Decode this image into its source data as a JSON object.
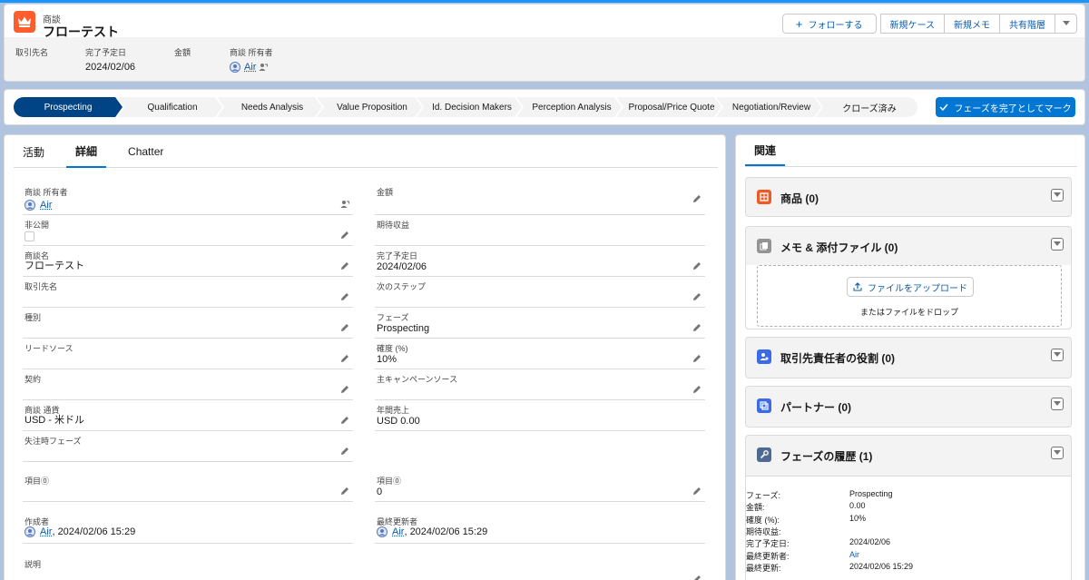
{
  "header": {
    "object_type": "商談",
    "record_name": "フローテスト",
    "actions": {
      "follow": "フォローする",
      "new_case": "新規ケース",
      "new_note": "新規メモ",
      "shared_hierarchy": "共有階層"
    },
    "highlights": [
      {
        "label": "取引先名",
        "value": ""
      },
      {
        "label": "完了予定日",
        "value": "2024/02/06"
      },
      {
        "label": "金額",
        "value": ""
      },
      {
        "label": "商談 所有者",
        "value": "Air"
      }
    ]
  },
  "path": {
    "steps": [
      "Prospecting",
      "Qualification",
      "Needs Analysis",
      "Value Proposition",
      "Id. Decision Makers",
      "Perception Analysis",
      "Proposal/Price Quote",
      "Negotiation/Review",
      "クローズ済み"
    ],
    "active_step": "Prospecting",
    "complete_button": "フェーズを完了としてマーク"
  },
  "tabs": [
    "活動",
    "詳細",
    "Chatter"
  ],
  "active_tab": "詳細",
  "details": {
    "owner": {
      "label": "商談 所有者",
      "value": "Air"
    },
    "amount": {
      "label": "金額",
      "value": ""
    },
    "private": {
      "label": "非公開",
      "checked": false
    },
    "expected_revenue": {
      "label": "期待収益",
      "value": ""
    },
    "name": {
      "label": "商談名",
      "value": "フローテスト"
    },
    "close_date": {
      "label": "完了予定日",
      "value": "2024/02/06"
    },
    "account": {
      "label": "取引先名",
      "value": ""
    },
    "next_step": {
      "label": "次のステップ",
      "value": ""
    },
    "type": {
      "label": "種別",
      "value": ""
    },
    "stage": {
      "label": "フェーズ",
      "value": "Prospecting"
    },
    "lead_source": {
      "label": "リードソース",
      "value": ""
    },
    "probability": {
      "label": "確度 (%)",
      "value": "10%"
    },
    "contract": {
      "label": "契約",
      "value": ""
    },
    "campaign": {
      "label": "主キャンペーンソース",
      "value": ""
    },
    "currency": {
      "label": "商談 通貨",
      "value": "USD - 米ドル"
    },
    "annual_revenue": {
      "label": "年間売上",
      "value": "USD 0.00"
    },
    "lost_stage": {
      "label": "失注時フェーズ",
      "value": ""
    },
    "item_left": {
      "label": "項目⓪",
      "value": ""
    },
    "item_right": {
      "label": "項目⓪",
      "value": "0"
    },
    "created_by": {
      "label": "作成者",
      "user": "Air",
      "date": ", 2024/02/06 15:29"
    },
    "modified_by": {
      "label": "最終更新者",
      "user": "Air",
      "date": ", 2024/02/06 15:29"
    },
    "description": {
      "label": "説明",
      "value": ""
    }
  },
  "related": {
    "tab": "関連",
    "products": "商品 (0)",
    "notes": "メモ & 添付ファイル (0)",
    "upload_button": "ファイルをアップロード",
    "drop_text": "またはファイルをドロップ",
    "contact_roles": "取引先責任者の役割 (0)",
    "partners": "パートナー (0)",
    "stage_history": "フェーズの履歴 (1)",
    "history": [
      {
        "k": "フェーズ:",
        "v": "Prospecting"
      },
      {
        "k": "金額:",
        "v": "0.00"
      },
      {
        "k": "確度 (%):",
        "v": "10%"
      },
      {
        "k": "期待収益:",
        "v": ""
      },
      {
        "k": "完了予定日:",
        "v": "2024/02/06"
      },
      {
        "k": "最終更新者:",
        "v": "Air"
      },
      {
        "k": "最終更新:",
        "v": "2024/02/06 15:29"
      }
    ]
  },
  "colors": {
    "brand": "#0176d3",
    "path_active": "#014486",
    "opportunity_icon": "#ff5d2d",
    "products_icon": "#ea5b27",
    "contact_roles_icon": "#3c6be8",
    "partners_icon": "#3c6be8",
    "history_icon": "#4f6a92"
  },
  "icons": [
    "crown-icon",
    "plus-icon",
    "chevron-down-icon",
    "check-icon",
    "pencil-icon",
    "avatar-icon",
    "change-owner-icon",
    "upload-icon"
  ]
}
